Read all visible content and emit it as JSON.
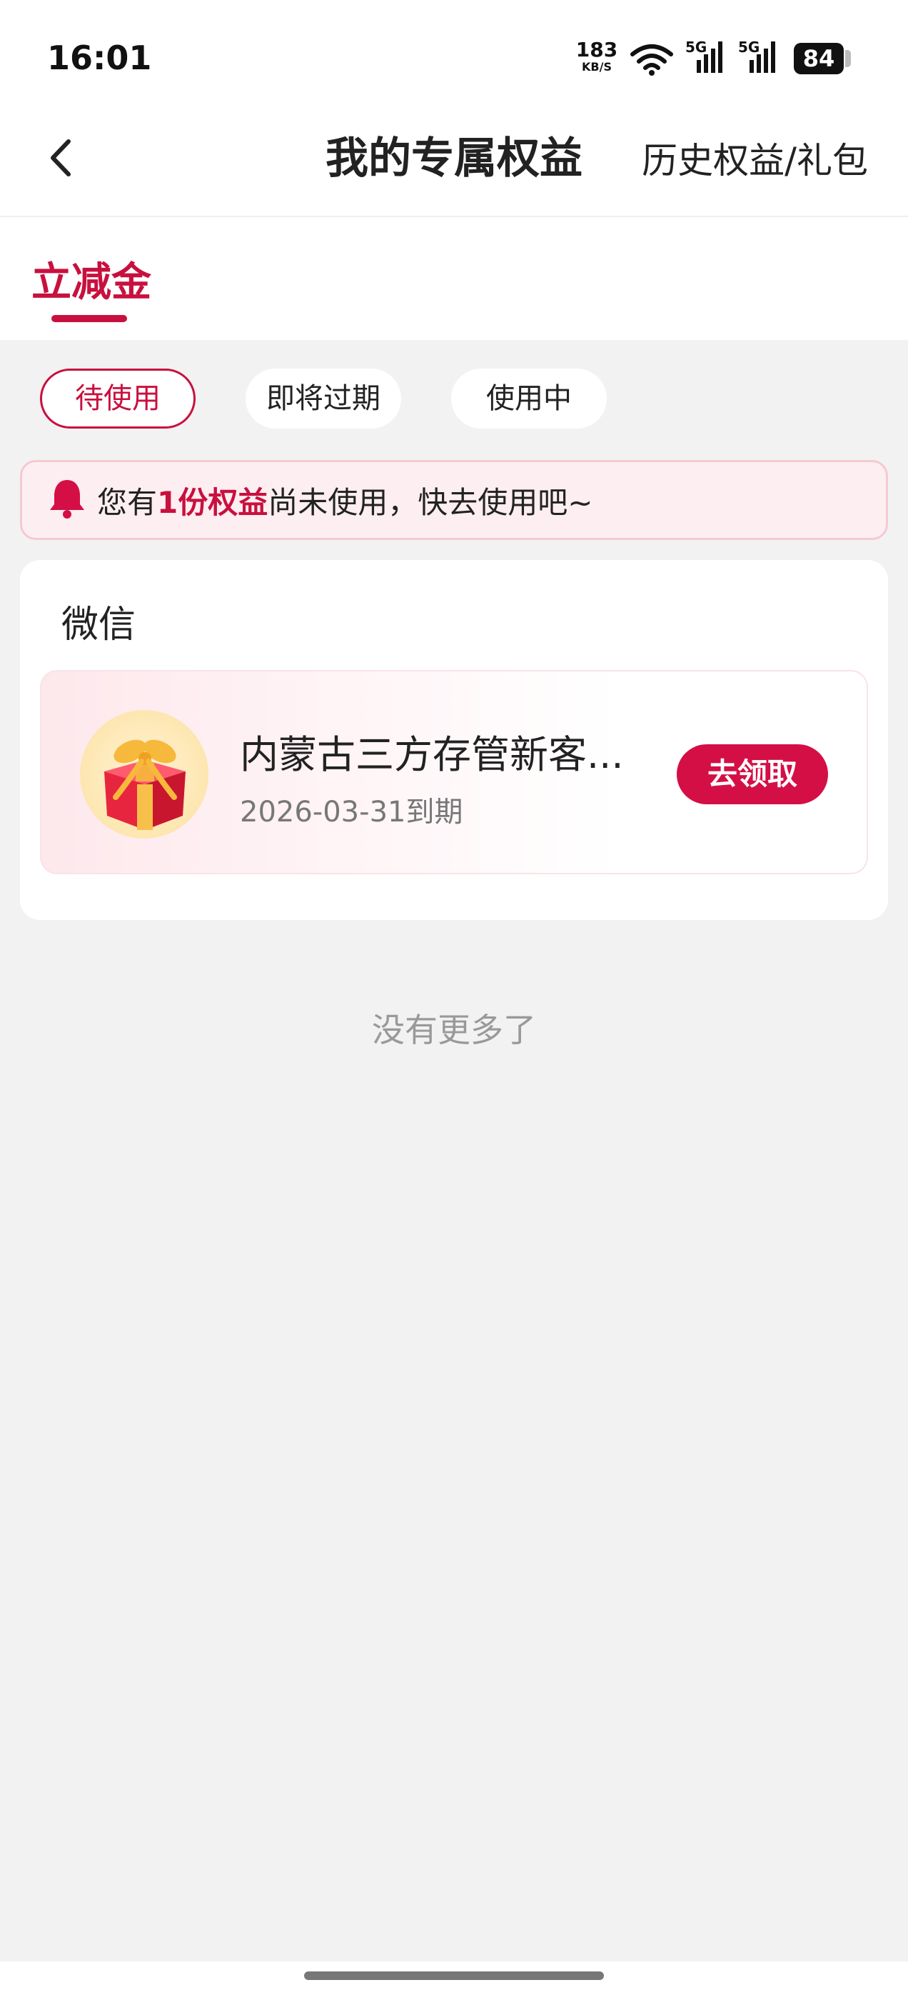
{
  "status_bar": {
    "time": "16:01",
    "net_speed_value": "183",
    "net_speed_unit": "KB/S",
    "signal_1_label": "5G",
    "signal_2_label": "5G",
    "battery": "84"
  },
  "header": {
    "title": "我的专属权益",
    "history_link": "历史权益/礼包"
  },
  "tabs": [
    {
      "label": "立减金",
      "active": true
    }
  ],
  "filters": [
    {
      "label": "待使用",
      "active": true
    },
    {
      "label": "即将过期",
      "active": false
    },
    {
      "label": "使用中",
      "active": false
    }
  ],
  "notice": {
    "prefix": "您有",
    "highlight": "1份权益",
    "suffix": "尚未使用，快去使用吧~"
  },
  "group": {
    "title": "微信",
    "items": [
      {
        "name": "内蒙古三方存管新客...",
        "expiry": "2026-03-31到期",
        "action": "去领取"
      }
    ]
  },
  "footer_text": "没有更多了",
  "colors": {
    "accent": "#c8103e",
    "button": "#d40f45",
    "background": "#f2f2f2"
  }
}
